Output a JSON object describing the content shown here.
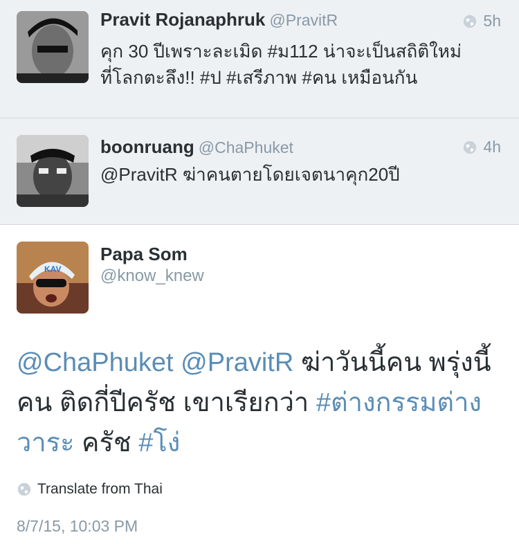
{
  "tweets": [
    {
      "name": "Pravit Rojanaphruk",
      "handle": "@PravitR",
      "time": "5h",
      "text_line1": "คุก 30 ปีเพราะละเมิด #ม112 น่าจะเป็นสถิติใหม่",
      "text_line2": "ที่โลกตะลึง!! #ป #เสรีภาพ #คน เหมือนกัน"
    },
    {
      "name": "boonruang",
      "handle": "@ChaPhuket",
      "time": "4h",
      "text_line1": "@PravitR ฆ่าคนตายโดยเจตนาคุก20ปี"
    }
  ],
  "main_tweet": {
    "name": "Papa Som",
    "handle": "@know_knew",
    "mention1": "@ChaPhuket",
    "mention2": "@PravitR",
    "text_a": " ฆ่าวันนี้คน พรุ่งนี้",
    "text_b": "คน ติดกี่ปีครัช เขาเรียกว่า ",
    "hashtag1": "#ต่างกรรมต่าง",
    "hashtag1_cont": "วาระ",
    "text_c": " ครัช ",
    "hashtag2": "#โง่",
    "translate_label": "Translate from Thai",
    "timestamp": "8/7/15, 10:03 PM"
  },
  "colors": {
    "link": "#5a8db6",
    "muted": "#8899a6",
    "context_bg": "#eef1f4"
  },
  "icons": {
    "globe": "globe-icon"
  }
}
